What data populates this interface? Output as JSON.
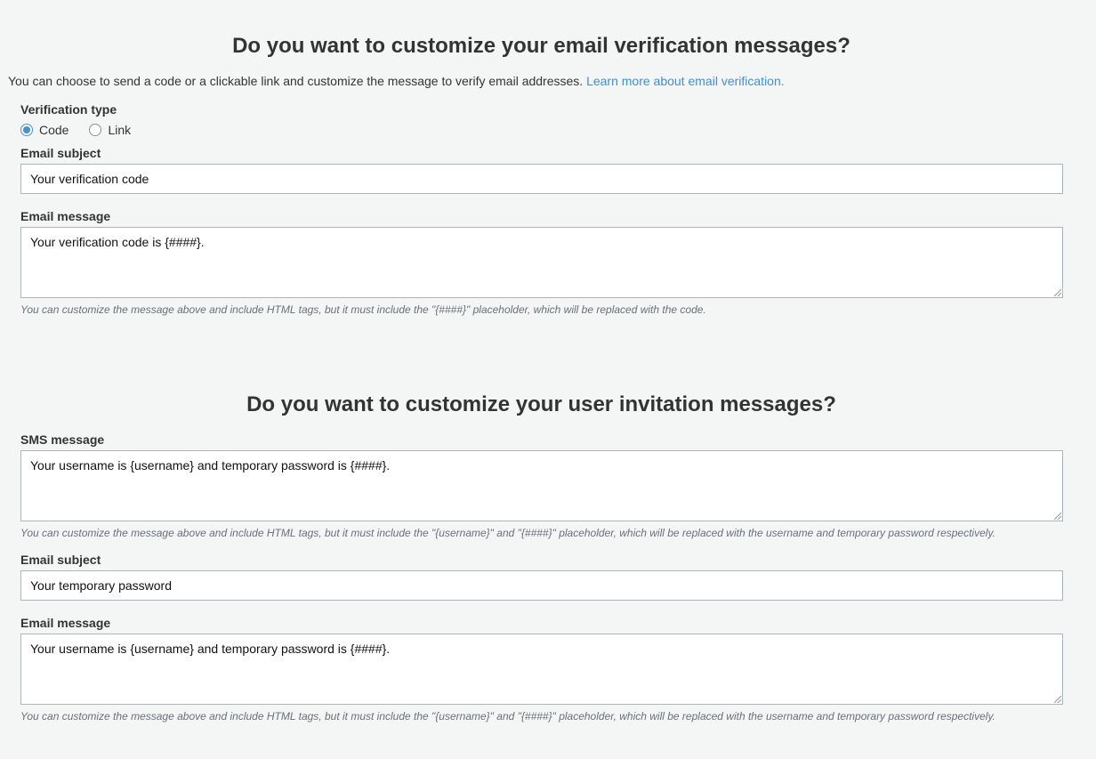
{
  "email_verification": {
    "heading": "Do you want to customize your email verification messages?",
    "intro_text": "You can choose to send a code or a clickable link and customize the message to verify email addresses.",
    "intro_link": "Learn more about email verification.",
    "verification_type_label": "Verification type",
    "options": [
      "Code",
      "Link"
    ],
    "selected_option": "Code",
    "subject_label": "Email subject",
    "subject_value": "Your verification code",
    "message_label": "Email message",
    "message_value": "Your verification code is {####}.",
    "hint": "You can customize the message above and include HTML tags, but it must include the \"{####}\" placeholder, which will be replaced with the code."
  },
  "user_invitation": {
    "heading": "Do you want to customize your user invitation messages?",
    "sms_label": "SMS message",
    "sms_value": "Your username is {username} and temporary password is {####}.",
    "sms_hint": "You can customize the message above and include HTML tags, but it must include the \"{username}\" and \"{####}\" placeholder, which will be replaced with the username and temporary password respectively.",
    "subject_label": "Email subject",
    "subject_value": "Your temporary password",
    "message_label": "Email message",
    "message_value": "Your username is {username} and temporary password is {####}.",
    "message_hint": "You can customize the message above and include HTML tags, but it must include the \"{username}\" and \"{####}\" placeholder, which will be replaced with the username and temporary password respectively."
  },
  "colors": {
    "link": "#3f8fd2",
    "radio_selected": "#4a90c9"
  }
}
